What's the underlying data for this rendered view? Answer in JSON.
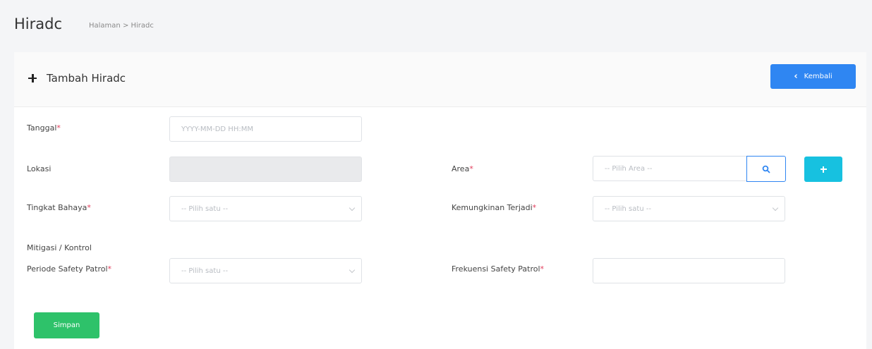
{
  "header": {
    "title": "Hiradc",
    "breadcrumb": "Halaman > Hiradc"
  },
  "card": {
    "title": "Tambah Hiradc",
    "back_label": "Kembali",
    "back_icon": "chevron-left-icon"
  },
  "form": {
    "tanggal": {
      "label": "Tanggal",
      "required": "*",
      "placeholder": "YYYY-MM-DD HH:MM"
    },
    "lokasi": {
      "label": "Lokasi",
      "value": ""
    },
    "area": {
      "label": "Area",
      "required": "*",
      "placeholder": "-- Pilih Area --",
      "search_icon": "search-icon",
      "add_icon": "plus-icon"
    },
    "tingkat_bahaya": {
      "label": "Tingkat Bahaya",
      "required": "*",
      "selected": "-- Pilih satu --"
    },
    "kemungkinan_terjadi": {
      "label": "Kemungkinan Terjadi",
      "required": "*",
      "selected": "-- Pilih satu --"
    },
    "section_mitigasi": "Mitigasi / Kontrol",
    "periode_safety_patrol": {
      "label": "Periode Safety Patrol",
      "required": "*",
      "selected": "-- Pilih satu --"
    },
    "frekuensi_safety_patrol": {
      "label": "Frekuensi Safety Patrol",
      "required": "*",
      "value": ""
    },
    "save_label": "Simpan"
  },
  "colors": {
    "primary": "#2f86f2",
    "info": "#17c1e0",
    "success": "#2ec26a",
    "required": "#e23d5b"
  }
}
